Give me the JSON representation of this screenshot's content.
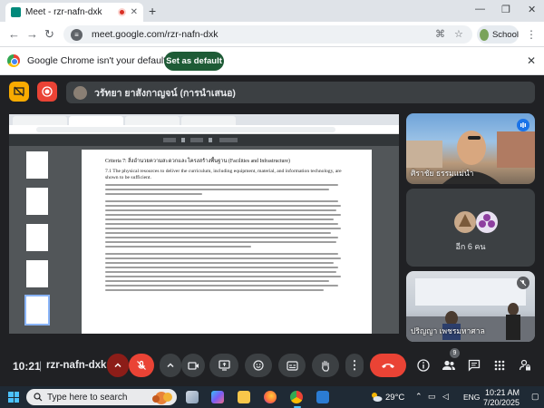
{
  "browser": {
    "tab_title": "Meet - rzr-nafn-dxk",
    "url": "meet.google.com/rzr-nafn-dxk",
    "profile_label": "School"
  },
  "infobar": {
    "message": "Google Chrome isn't your default browser",
    "button_label": "Set as default"
  },
  "meet": {
    "presenter_label": "วรัทยา ยาสังกาญจน์ (การนำเสนอ)",
    "time": "10:21",
    "separator": "|",
    "meeting_code": "rzr-nafn-dxk",
    "people_badge": "9",
    "colors": {
      "leave": "#ea4335",
      "mic_off": "#ea4335",
      "accent": "#8ab4f8"
    }
  },
  "document": {
    "criteria_title": "Criteria 7: สิ่งอำนวยความสะดวกและโครงสร้างพื้นฐาน (Facilities and Infrastructure)",
    "section": "7.1 The physical resources to deliver the curriculum, including equipment, material, and information technology, are shown to be sufficient."
  },
  "tiles": [
    {
      "name": "ศิราชัย ธรรมแม่นำ",
      "indicator": "speaking"
    },
    {
      "name": "อีก 6 คน",
      "indicator": "none"
    },
    {
      "name": "ปริญญา เพชรมหาศาล",
      "indicator": "muted"
    }
  ],
  "taskbar": {
    "search_placeholder": "Type here to search",
    "temperature": "29°C",
    "language": "ENG",
    "clock_time": "10:21 AM",
    "clock_date": "7/20/2025"
  }
}
